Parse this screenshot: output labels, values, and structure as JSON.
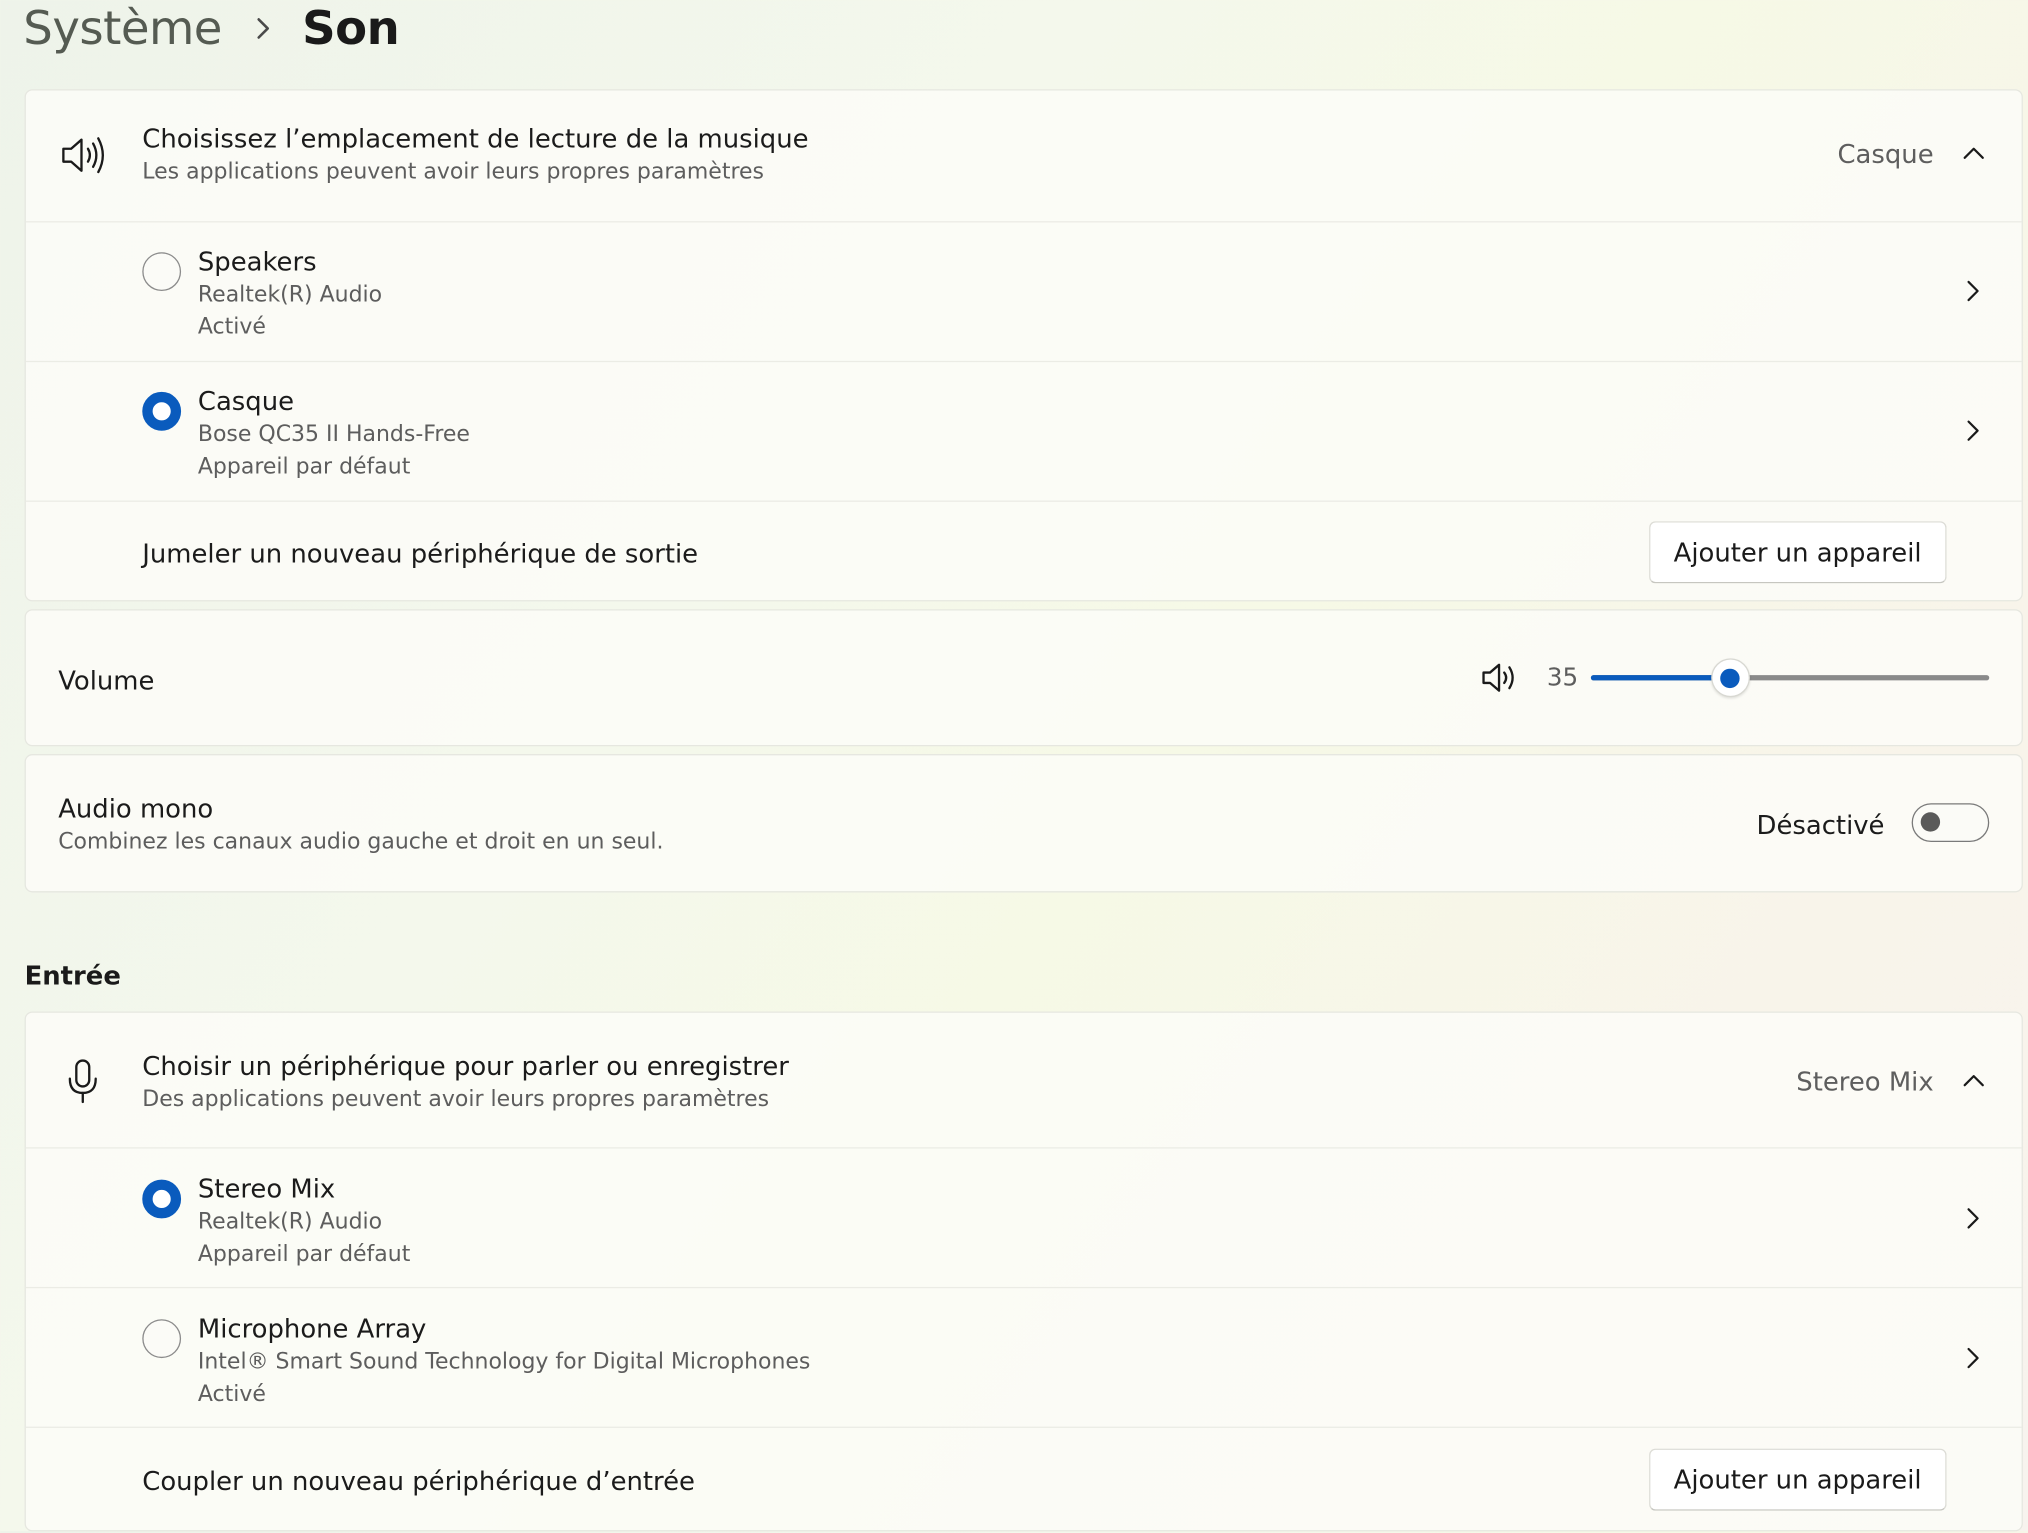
{
  "breadcrumb": {
    "parent": "Système",
    "current": "Son"
  },
  "output": {
    "header": {
      "title": "Choisissez l’emplacement de lecture de la musique",
      "subtitle": "Les applications peuvent avoir leurs propres paramètres",
      "selected": "Casque",
      "icon": "speaker-icon"
    },
    "devices": [
      {
        "name": "Speakers",
        "driver": "Realtek(R) Audio",
        "status": "Activé",
        "selected": false
      },
      {
        "name": "Casque",
        "driver": "Bose QC35 II Hands-Free",
        "status": "Appareil par défaut",
        "selected": true
      }
    ],
    "pair": {
      "label": "Jumeler un nouveau périphérique de sortie",
      "button": "Ajouter un appareil"
    }
  },
  "volume": {
    "label": "Volume",
    "value": "35",
    "level": 35,
    "icon": "volume-icon"
  },
  "mono": {
    "title": "Audio mono",
    "subtitle": "Combinez les canaux audio gauche et droit en un seul.",
    "state": "Désactivé",
    "on": false
  },
  "input": {
    "section_title": "Entrée",
    "header": {
      "title": "Choisir un périphérique pour parler ou enregistrer",
      "subtitle": "Des applications peuvent avoir leurs propres paramètres",
      "selected": "Stereo Mix",
      "icon": "microphone-icon"
    },
    "devices": [
      {
        "name": "Stereo Mix",
        "driver": "Realtek(R) Audio",
        "status": "Appareil par défaut",
        "selected": true
      },
      {
        "name": "Microphone Array",
        "driver": "Intel® Smart Sound Technology for Digital Microphones",
        "status": "Activé",
        "selected": false
      }
    ],
    "pair": {
      "label": "Coupler un nouveau périphérique d’entrée",
      "button": "Ajouter un appareil"
    }
  },
  "colors": {
    "accent": "#0a5bbd",
    "card": "#fcfcf7",
    "text": "#1b1b1b",
    "secondary_text": "#5d5d5d"
  }
}
